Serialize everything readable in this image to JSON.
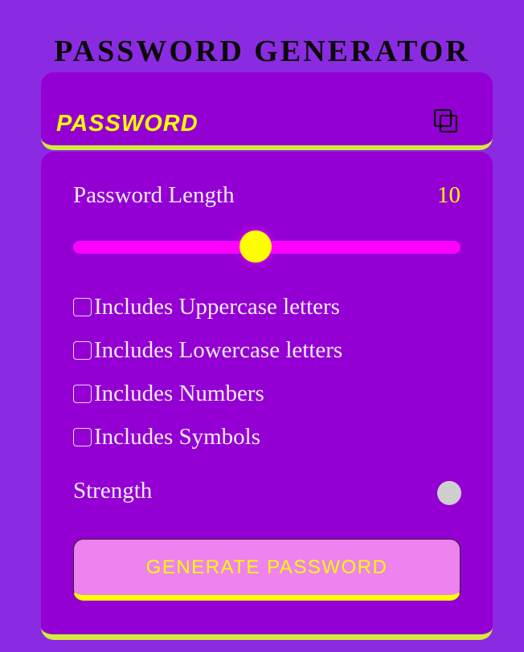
{
  "app": {
    "title": "PASSWORD GENERATOR"
  },
  "display": {
    "password_text": "PASSWORD",
    "copy_icon": "copy-icon"
  },
  "length": {
    "label": "Password Length",
    "value": "10",
    "slider_fraction": 0.47
  },
  "options": [
    {
      "label": "Includes Uppercase letters",
      "checked": false
    },
    {
      "label": "Includes Lowercase letters",
      "checked": false
    },
    {
      "label": "Includes Numbers",
      "checked": false
    },
    {
      "label": "Includes Symbols",
      "checked": false
    }
  ],
  "strength": {
    "label": "Strength",
    "indicator_color": "#cfcfcf"
  },
  "generate": {
    "label": "GENERATE PASSWORD"
  },
  "colors": {
    "background": "#8a2be2",
    "panel": "#9400d3",
    "accent_yellow": "#ffff00",
    "slider_track": "#ff00ff",
    "button_bg": "#ee82ee",
    "border_lime": "#d4ea3c"
  }
}
